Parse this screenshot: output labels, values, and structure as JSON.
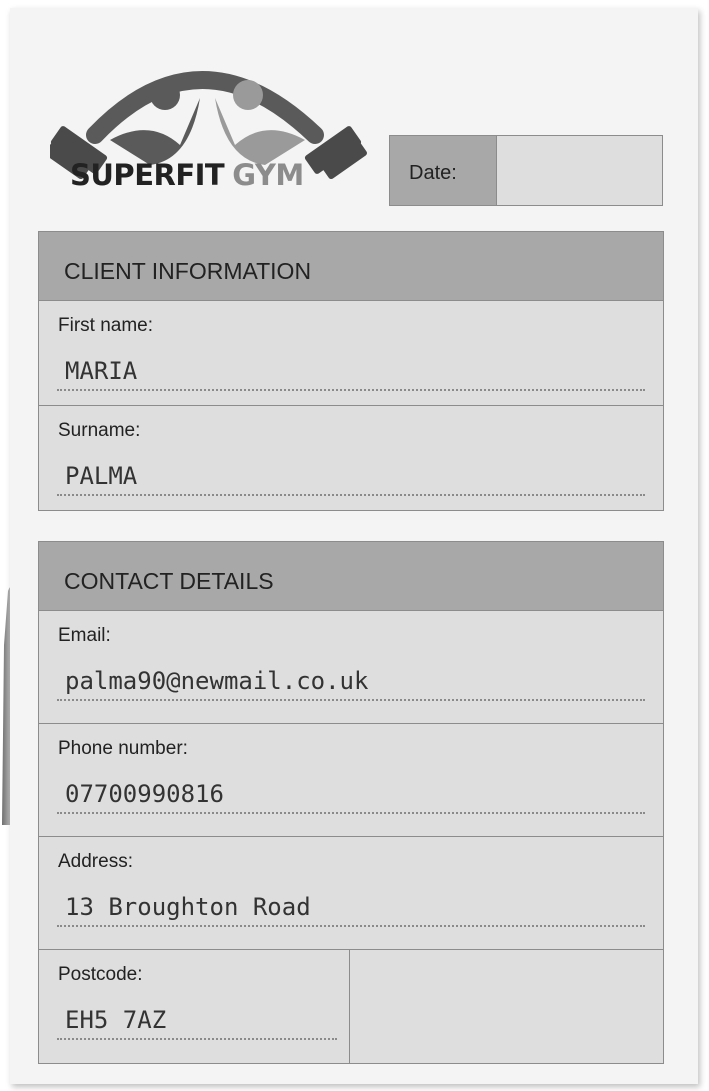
{
  "brand": {
    "name_primary": "SUPERFIT",
    "name_secondary": "GYM"
  },
  "date": {
    "label": "Date:",
    "value": ""
  },
  "client_information": {
    "title": "CLIENT INFORMATION",
    "fields": [
      {
        "label": "First name:",
        "value": "MARIA"
      },
      {
        "label": "Surname:",
        "value": "PALMA"
      }
    ]
  },
  "contact_details": {
    "title": "CONTACT DETAILS",
    "fields": [
      {
        "label": "Email:",
        "value": "palma90@newmail.co.uk"
      },
      {
        "label": "Phone number:",
        "value": "07700990816"
      },
      {
        "label": "Address:",
        "value": "13 Broughton Road"
      },
      {
        "label": "Postcode:",
        "value": "EH5 7AZ"
      }
    ]
  },
  "colors": {
    "header_gray": "#a8a8a8",
    "field_gray": "#dedede",
    "logo_dark": "#5a5a5a",
    "logo_light": "#9a9a9a"
  }
}
